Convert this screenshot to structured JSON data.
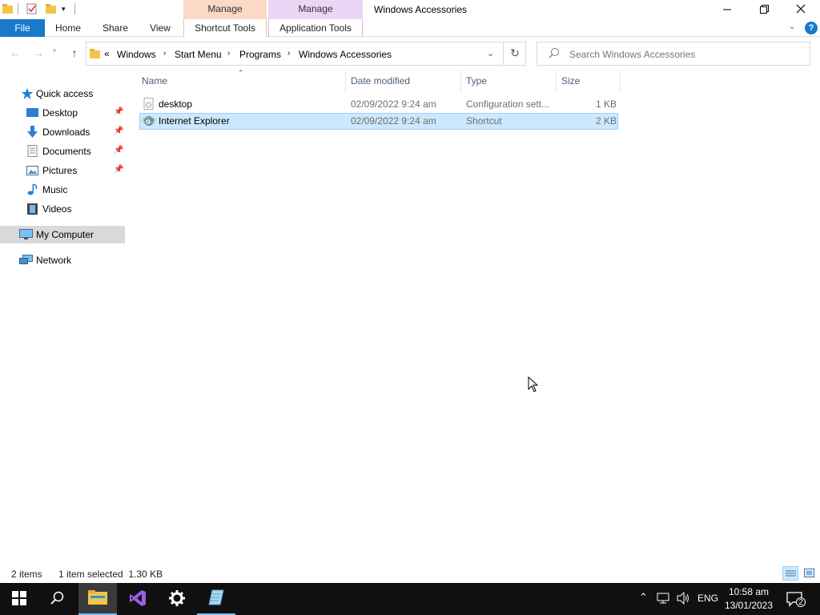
{
  "titlebar": {
    "title": "Windows Accessories",
    "context_tab_1": "Manage",
    "context_tab_2": "Manage"
  },
  "ribbon": {
    "tabs": [
      "File",
      "Home",
      "Share",
      "View",
      "Shortcut Tools",
      "Application Tools"
    ]
  },
  "address": {
    "overflow": "«",
    "crumbs": [
      "Windows",
      "Start Menu",
      "Programs",
      "Windows Accessories"
    ],
    "search_placeholder": "Search Windows Accessories"
  },
  "nav": {
    "items": [
      {
        "label": "Quick access",
        "icon": "star-icon"
      },
      {
        "label": "Desktop",
        "icon": "desktop-icon",
        "pinned": true
      },
      {
        "label": "Downloads",
        "icon": "downloads-icon",
        "pinned": true
      },
      {
        "label": "Documents",
        "icon": "documents-icon",
        "pinned": true
      },
      {
        "label": "Pictures",
        "icon": "pictures-icon",
        "pinned": true
      },
      {
        "label": "Music",
        "icon": "music-icon"
      },
      {
        "label": "Videos",
        "icon": "videos-icon"
      },
      {
        "label": "My Computer",
        "icon": "computer-icon",
        "selected": true
      },
      {
        "label": "Network",
        "icon": "network-icon"
      }
    ]
  },
  "files": {
    "columns": [
      "Name",
      "Date modified",
      "Type",
      "Size"
    ],
    "rows": [
      {
        "name": "desktop",
        "date": "02/09/2022 9:24 am",
        "type": "Configuration sett...",
        "size": "1 KB",
        "icon": "config-file-icon"
      },
      {
        "name": "Internet Explorer",
        "date": "02/09/2022 9:24 am",
        "type": "Shortcut",
        "size": "2 KB",
        "icon": "internet-explorer-icon",
        "selected": true
      }
    ]
  },
  "status": {
    "count": "2 items",
    "selection": "1 item selected  1.30 KB"
  },
  "taskbar": {
    "language": "ENG",
    "time": "10:58 am",
    "date": "13/01/2023",
    "notifications": "2"
  },
  "colors": {
    "accent": "#1979ca",
    "selection_bg": "#cce8ff",
    "selection_border": "#99d1ff",
    "context_manage_1": "#fcd9c4",
    "context_manage_2": "#ead5f5",
    "taskbar": "#101010"
  }
}
